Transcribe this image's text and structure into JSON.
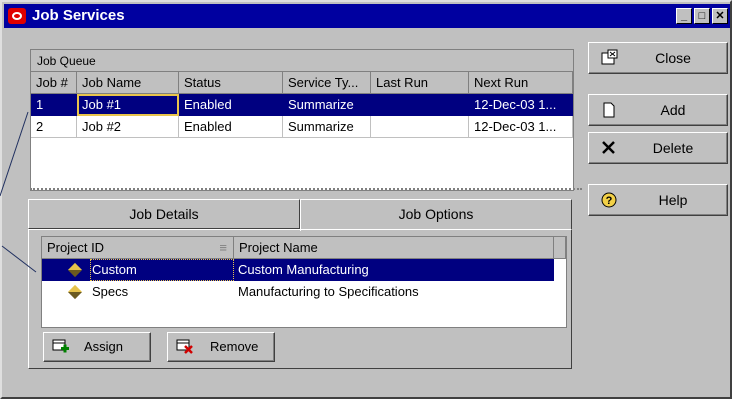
{
  "window": {
    "title": "Job Services"
  },
  "title_buttons": {
    "minimize": "_",
    "maximize": "□",
    "close": "✕"
  },
  "job_queue": {
    "caption": "Job Queue",
    "columns": [
      "Job #",
      "Job Name",
      "Status",
      "Service Ty...",
      "Last Run",
      "Next Run"
    ],
    "rows": [
      {
        "num": "1",
        "name": "Job #1",
        "status": "Enabled",
        "service": "Summarize",
        "last": "",
        "next": "12-Dec-03 1...",
        "selected": true
      },
      {
        "num": "2",
        "name": "Job #2",
        "status": "Enabled",
        "service": "Summarize",
        "last": "",
        "next": "12-Dec-03 1...",
        "selected": false
      }
    ]
  },
  "tabs": {
    "details": "Job Details",
    "options": "Job Options"
  },
  "projects": {
    "columns": [
      "Project ID",
      "Project Name"
    ],
    "rows": [
      {
        "id": "Custom",
        "name": "Custom Manufacturing",
        "selected": true
      },
      {
        "id": "Specs",
        "name": "Manufacturing to Specifications",
        "selected": false
      }
    ]
  },
  "buttons": {
    "assign": "Assign",
    "remove": "Remove",
    "close": "Close",
    "add": "Add",
    "delete": "Delete",
    "help": "Help"
  },
  "colors": {
    "selection": "#000080",
    "titlebar": "#0000a0",
    "face": "#c0c0c0"
  }
}
